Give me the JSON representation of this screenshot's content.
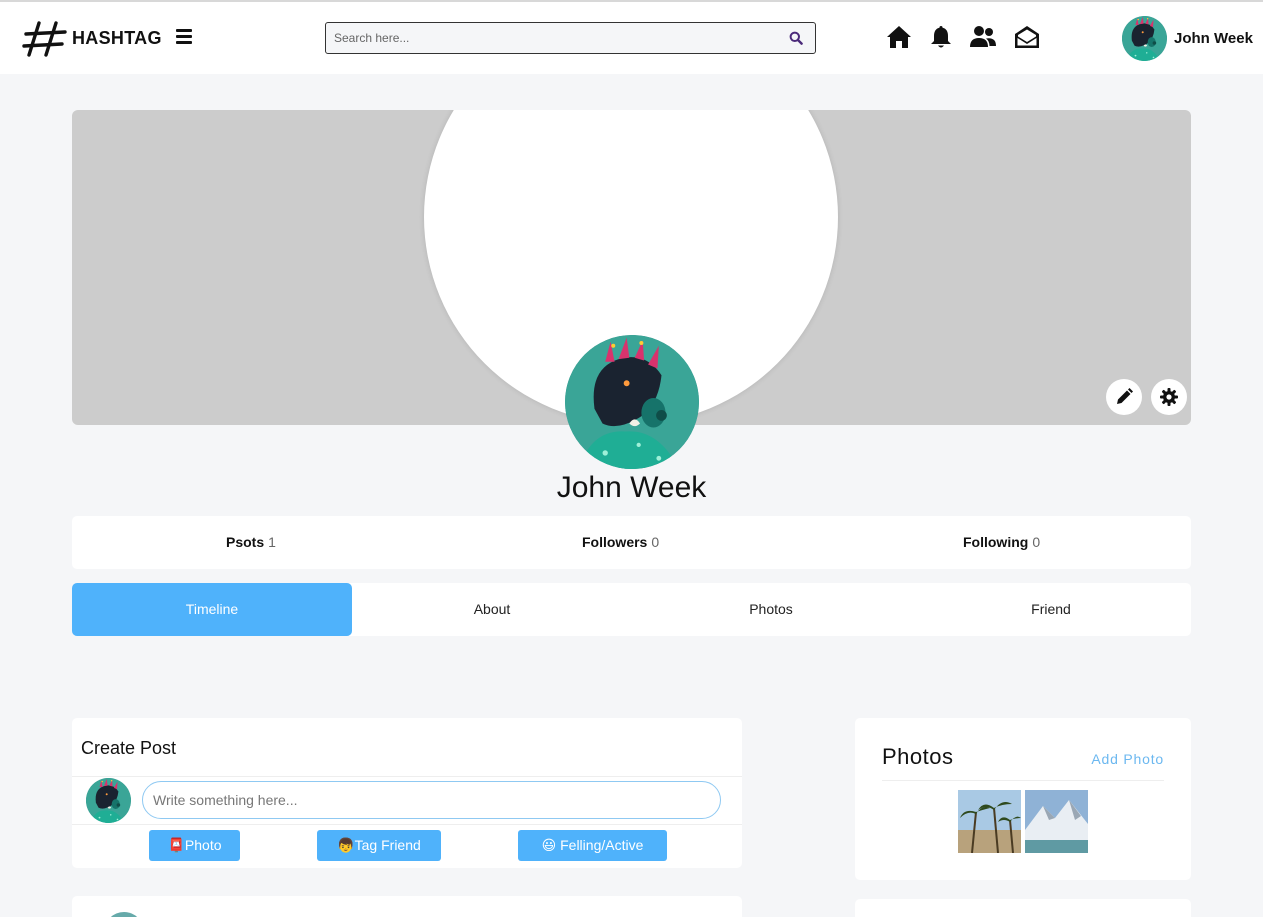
{
  "app": {
    "name": "HASHTAG"
  },
  "header": {
    "search_placeholder": "Search here...",
    "user_name": "John Week",
    "icons": [
      "home-icon",
      "bell-icon",
      "friends-icon",
      "mail-open-icon"
    ]
  },
  "profile": {
    "name": "John Week",
    "stats": [
      {
        "label": "Psots",
        "value": "1"
      },
      {
        "label": "Followers",
        "value": "0"
      },
      {
        "label": "Following",
        "value": "0"
      }
    ]
  },
  "tabs": [
    {
      "label": "Timeline",
      "active": true
    },
    {
      "label": "About",
      "active": false
    },
    {
      "label": "Photos",
      "active": false
    },
    {
      "label": "Friend",
      "active": false
    }
  ],
  "create_post": {
    "title": "Create Post",
    "placeholder": "Write something here...",
    "buttons": [
      {
        "emoji": "📮",
        "label": "Photo"
      },
      {
        "emoji": "👦",
        "label": "Tag Friend"
      },
      {
        "emoji": "😃",
        "label": " Felling/Active"
      }
    ]
  },
  "photos_widget": {
    "title": "Photos",
    "add_label": "Add Photo",
    "thumbnails": [
      "palm-trees-photo",
      "snowy-mountain-photo"
    ]
  },
  "colors": {
    "accent": "#4fb2fb",
    "cover": "#cccccc",
    "background": "#f5f6f8"
  }
}
